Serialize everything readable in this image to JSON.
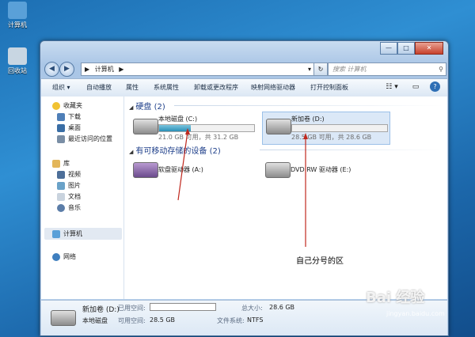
{
  "desktop": {
    "icons": [
      {
        "label": "计算机",
        "color": "#5aa0d8"
      },
      {
        "label": "回收站",
        "color": "#c8d6e2"
      }
    ]
  },
  "window": {
    "caption_buttons": [
      "—",
      "□",
      "✕"
    ],
    "nav": {
      "back": "◀",
      "forward": "▶"
    },
    "address": {
      "root": "▶",
      "segment": "计算机",
      "arrow": "▶",
      "dropdown": "▾"
    },
    "refresh": "↻",
    "search": {
      "placeholder": "搜索 计算机",
      "icon": "⚲"
    },
    "toolbar": {
      "items": [
        "组织 ▾",
        "自动播放",
        "属性",
        "系统属性",
        "卸载或更改程序",
        "映射网络驱动器",
        "打开控制面板"
      ],
      "view_icon": "☷ ▾",
      "pane_icon": "▭",
      "help_icon": "?"
    },
    "nav_pane": {
      "favorites": {
        "title": "收藏夹",
        "items": [
          "下载",
          "桌面",
          "最近访问的位置"
        ]
      },
      "libraries": {
        "title": "库",
        "items": [
          "视频",
          "图片",
          "文档",
          "音乐"
        ]
      },
      "computer": "计算机",
      "network": "网络"
    },
    "groups": {
      "hard_disks": {
        "title": "硬盘 (2)",
        "drives": [
          {
            "name": "本地磁盘 (C:)",
            "free": "21.0 GB 可用，共 31.2 GB",
            "used_fraction": 0.33
          },
          {
            "name": "新加卷 (D:)",
            "free": "28.5 GB 可用，共 28.6 GB",
            "used_fraction": 0.004
          }
        ]
      },
      "removable": {
        "title": "有可移动存储的设备 (2)",
        "devices": [
          {
            "name": "软盘驱动器 (A:)"
          },
          {
            "name": "DVD RW 驱动器 (E:)"
          }
        ]
      }
    },
    "details": {
      "name": "新加卷 (D:)",
      "type": "本地磁盘",
      "used_label": "已用空间:",
      "free_label": "可用空间:",
      "free_value": "28.5 GB",
      "total_label": "总大小:",
      "total_value": "28.6 GB",
      "fs_label": "文件系统:",
      "fs_value": "NTFS"
    }
  },
  "annotation": {
    "text": "自己分号的区",
    "color": "#c0281e"
  },
  "watermark": {
    "main": "Bai 经验",
    "sub": "jingyan.baidu.com"
  }
}
